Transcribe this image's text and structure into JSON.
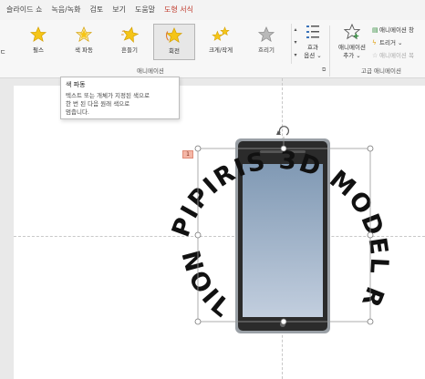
{
  "menu": {
    "tabs": [
      "슬라이드 쇼",
      "녹음/녹화",
      "검토",
      "보기",
      "도움말",
      "도형 서식"
    ],
    "active_tab": "도형 서식"
  },
  "ribbon": {
    "partial_left_label": "ㄷ",
    "effects": [
      {
        "label": "펄스",
        "icon": "pulse-star-icon"
      },
      {
        "label": "색 파동",
        "icon": "color-wave-star-icon"
      },
      {
        "label": "흔들기",
        "icon": "teeter-star-icon"
      },
      {
        "label": "회전",
        "icon": "spin-star-icon",
        "selected": true
      },
      {
        "label": "크게/작게",
        "icon": "grow-shrink-star-icon"
      },
      {
        "label": "흐리기",
        "icon": "desaturate-star-icon"
      }
    ],
    "effect_options": {
      "label1": "효과",
      "label2": "옵션 ⌄"
    },
    "group_animation_label": "애니메이션",
    "add_animation": {
      "label1": "애니메이션",
      "label2": "추가 ⌄"
    },
    "advanced": [
      {
        "label": "애니메이션 창",
        "icon": "animation-pane-icon",
        "disabled": false
      },
      {
        "label": "트리거 ⌄",
        "icon": "trigger-icon",
        "disabled": false
      },
      {
        "label": "애니메이션 복",
        "icon": "animation-painter-icon",
        "disabled": true
      }
    ],
    "group_advanced_label": "고급 애니메이션",
    "accent_color": "#c0392b"
  },
  "tooltip": {
    "title": "색 파동",
    "description_lines": [
      "텍스트 또는 개체가 지정된 색으로",
      "한 번 된 다음 원래 색으로",
      "멈춥니다."
    ]
  },
  "slide": {
    "animation_tag": "1",
    "circular_text": "PIPIRIS 3D MODEL R",
    "bottom_text": "NOIL",
    "colors": {
      "phone_screen_top": "#8099b4",
      "phone_screen_bottom": "#c2cede",
      "phone_body": "#2b2b2b",
      "text": "#111111"
    }
  }
}
